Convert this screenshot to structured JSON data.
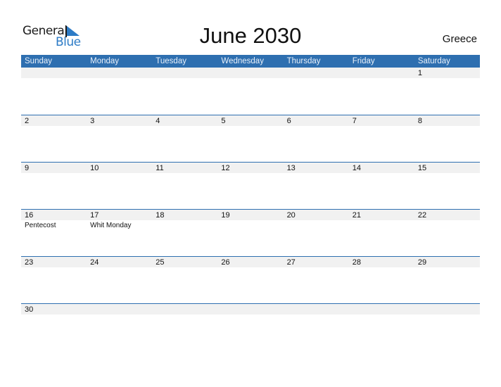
{
  "logo": {
    "word1": "General",
    "word2": "Blue"
  },
  "title": "June 2030",
  "country": "Greece",
  "weekdays": [
    "Sunday",
    "Monday",
    "Tuesday",
    "Wednesday",
    "Thursday",
    "Friday",
    "Saturday"
  ],
  "weeks": [
    [
      {
        "day": ""
      },
      {
        "day": ""
      },
      {
        "day": ""
      },
      {
        "day": ""
      },
      {
        "day": ""
      },
      {
        "day": ""
      },
      {
        "day": "1"
      }
    ],
    [
      {
        "day": "2"
      },
      {
        "day": "3"
      },
      {
        "day": "4"
      },
      {
        "day": "5"
      },
      {
        "day": "6"
      },
      {
        "day": "7"
      },
      {
        "day": "8"
      }
    ],
    [
      {
        "day": "9"
      },
      {
        "day": "10"
      },
      {
        "day": "11"
      },
      {
        "day": "12"
      },
      {
        "day": "13"
      },
      {
        "day": "14"
      },
      {
        "day": "15"
      }
    ],
    [
      {
        "day": "16",
        "holiday": "Pentecost"
      },
      {
        "day": "17",
        "holiday": "Whit Monday"
      },
      {
        "day": "18"
      },
      {
        "day": "19"
      },
      {
        "day": "20"
      },
      {
        "day": "21"
      },
      {
        "day": "22"
      }
    ],
    [
      {
        "day": "23"
      },
      {
        "day": "24"
      },
      {
        "day": "25"
      },
      {
        "day": "26"
      },
      {
        "day": "27"
      },
      {
        "day": "28"
      },
      {
        "day": "29"
      }
    ],
    [
      {
        "day": "30"
      },
      {
        "day": ""
      },
      {
        "day": ""
      },
      {
        "day": ""
      },
      {
        "day": ""
      },
      {
        "day": ""
      },
      {
        "day": ""
      }
    ]
  ],
  "colors": {
    "header": "#2e6fb0",
    "accent": "#2c7bc6",
    "band": "#f1f1f1"
  }
}
